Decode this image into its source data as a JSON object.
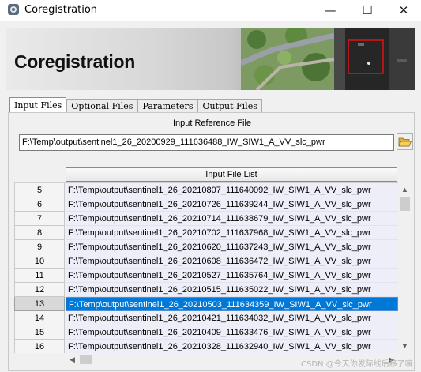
{
  "window": {
    "title": "Coregistration",
    "minimize": "—",
    "maximize": "☐",
    "close": "✕"
  },
  "banner": {
    "title": "Coregistration"
  },
  "tabs": [
    {
      "label": "Input Files",
      "active": true
    },
    {
      "label": "Optional Files",
      "active": false
    },
    {
      "label": "Parameters",
      "active": false
    },
    {
      "label": "Output Files",
      "active": false
    }
  ],
  "input_reference": {
    "label": "Input Reference File",
    "value": "F:\\Temp\\output\\sentinel1_26_20200929_111636488_IW_SIW1_A_VV_slc_pwr"
  },
  "file_list": {
    "header": "Input File List",
    "rows": [
      {
        "num": "5",
        "path": "F:\\Temp\\output\\sentinel1_26_20210807_111640092_IW_SIW1_A_VV_slc_pwr"
      },
      {
        "num": "6",
        "path": "F:\\Temp\\output\\sentinel1_26_20210726_111639244_IW_SIW1_A_VV_slc_pwr"
      },
      {
        "num": "7",
        "path": "F:\\Temp\\output\\sentinel1_26_20210714_111638679_IW_SIW1_A_VV_slc_pwr"
      },
      {
        "num": "8",
        "path": "F:\\Temp\\output\\sentinel1_26_20210702_111637968_IW_SIW1_A_VV_slc_pwr"
      },
      {
        "num": "9",
        "path": "F:\\Temp\\output\\sentinel1_26_20210620_111637243_IW_SIW1_A_VV_slc_pwr"
      },
      {
        "num": "10",
        "path": "F:\\Temp\\output\\sentinel1_26_20210608_111636472_IW_SIW1_A_VV_slc_pwr"
      },
      {
        "num": "11",
        "path": "F:\\Temp\\output\\sentinel1_26_20210527_111635764_IW_SIW1_A_VV_slc_pwr"
      },
      {
        "num": "12",
        "path": "F:\\Temp\\output\\sentinel1_26_20210515_111635022_IW_SIW1_A_VV_slc_pwr"
      },
      {
        "num": "13",
        "path": "F:\\Temp\\output\\sentinel1_26_20210503_111634359_IW_SIW1_A_VV_slc_pwr",
        "selected": true
      },
      {
        "num": "14",
        "path": "F:\\Temp\\output\\sentinel1_26_20210421_111634032_IW_SIW1_A_VV_slc_pwr"
      },
      {
        "num": "15",
        "path": "F:\\Temp\\output\\sentinel1_26_20210409_111633476_IW_SIW1_A_VV_slc_pwr"
      },
      {
        "num": "16",
        "path": "F:\\Temp\\output\\sentinel1_26_20210328_111632940_IW_SIW1_A_VV_slc_pwr"
      }
    ]
  },
  "scroll_arrows": {
    "up": "▲",
    "down": "▼",
    "left": "◀",
    "right": "▶"
  },
  "watermark": "CSDN @今天你发际线后移了嘛",
  "colors": {
    "selection": "#0078d7",
    "row_bg": "#eeeef8",
    "window_bg": "#f0f0f0"
  },
  "icons": {
    "app": "app-icon",
    "folder": "folder-open-icon"
  }
}
